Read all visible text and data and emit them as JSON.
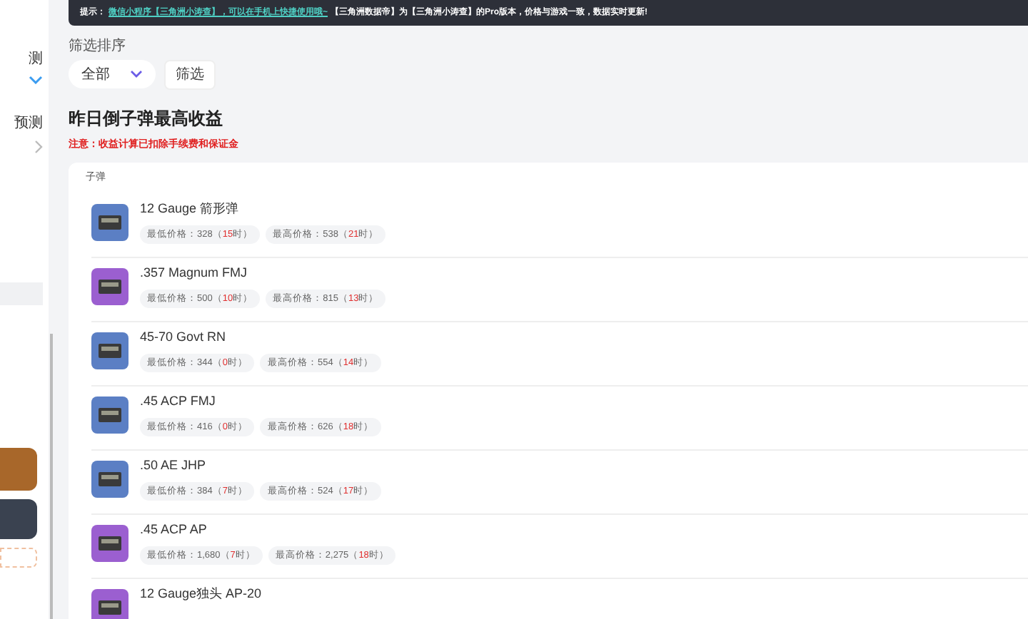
{
  "sidebar": {
    "items": [
      {
        "label": "测",
        "expanded": true
      },
      {
        "label": "预测",
        "expanded": false
      }
    ]
  },
  "notice": {
    "prefix": "提示：",
    "link": "微信小程序【三角洲小涛查】，可以在手机上快捷使用哦~",
    "text": "【三角洲数据帝】为【三角洲小涛查】的Pro版本，价格与游戏一致，数据实时更新!"
  },
  "filter": {
    "label": "筛选排序",
    "select": "全部",
    "button": "筛选"
  },
  "section": {
    "title": "昨日倒子弹最高收益",
    "warning": "注意：收益计算已扣除手续费和保证金"
  },
  "card": {
    "category": "子弹",
    "items": [
      {
        "name": "12 Gauge 箭形弹",
        "color": "#5b7fc4",
        "pills": [
          {
            "prefix": "最低价格：328（",
            "hour": "15",
            "suffix": "时）"
          },
          {
            "prefix": "最高价格：538（",
            "hour": "21",
            "suffix": "时）"
          }
        ]
      },
      {
        "name": ".357 Magnum FMJ",
        "color": "#9b5fd0",
        "pills": [
          {
            "prefix": "最低价格：500（",
            "hour": "10",
            "suffix": "时）"
          },
          {
            "prefix": "最高价格：815（",
            "hour": "13",
            "suffix": "时）"
          }
        ]
      },
      {
        "name": "45-70 Govt RN",
        "color": "#5b7fc4",
        "pills": [
          {
            "prefix": "最低价格：344（",
            "hour": "0",
            "suffix": "时）"
          },
          {
            "prefix": "最高价格：554（",
            "hour": "14",
            "suffix": "时）"
          }
        ]
      },
      {
        "name": ".45 ACP FMJ",
        "color": "#5b7fc4",
        "pills": [
          {
            "prefix": "最低价格：416（",
            "hour": "0",
            "suffix": "时）"
          },
          {
            "prefix": "最高价格：626（",
            "hour": "18",
            "suffix": "时）"
          }
        ]
      },
      {
        "name": ".50 AE JHP",
        "color": "#5b7fc4",
        "pills": [
          {
            "prefix": "最低价格：384（",
            "hour": "7",
            "suffix": "时）"
          },
          {
            "prefix": "最高价格：524（",
            "hour": "17",
            "suffix": "时）"
          }
        ]
      },
      {
        "name": ".45 ACP AP",
        "color": "#9b5fd0",
        "pills": [
          {
            "prefix": "最低价格：1,680（",
            "hour": "7",
            "suffix": "时）"
          },
          {
            "prefix": "最高价格：2,275（",
            "hour": "18",
            "suffix": "时）"
          }
        ]
      },
      {
        "name": "12 Gauge独头 AP-20",
        "color": "#9b5fd0"
      }
    ]
  }
}
